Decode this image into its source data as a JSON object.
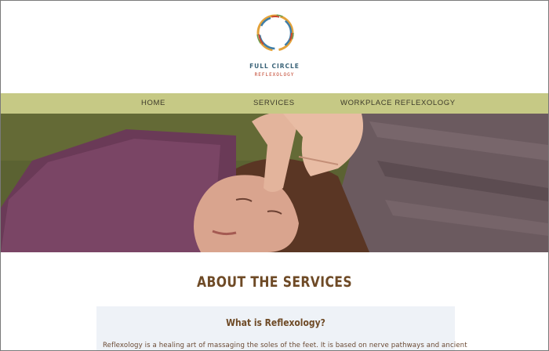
{
  "brand": {
    "name": "FULL CIRCLE",
    "subtitle": "REFLEXOLOGY",
    "logo_icon": "circle-brushstroke-logo",
    "colors": {
      "name": "#3a6378",
      "subtitle": "#c0412a"
    }
  },
  "nav": {
    "items": [
      {
        "label": "HOME"
      },
      {
        "label": "SERVICES"
      },
      {
        "label": "WORKPLACE REFLEXOLOGY"
      }
    ],
    "background": "#c6c985"
  },
  "hero": {
    "image": "woman-receiving-facial-reflexology-on-purple-blanket"
  },
  "main": {
    "title": "ABOUT THE SERVICES",
    "card": {
      "title": "What is Reflexology?",
      "text": "Reflexology is a healing art of massaging the soles of the feet. It is based on nerve pathways and ancient"
    },
    "accent_color": "#6e4a26"
  }
}
